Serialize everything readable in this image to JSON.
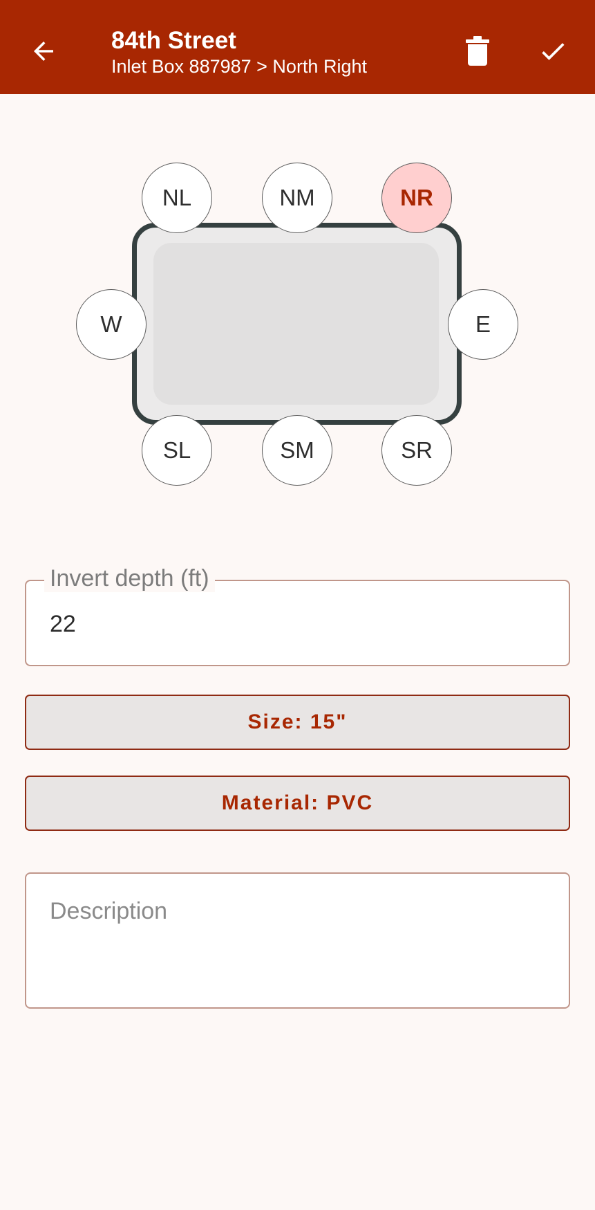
{
  "app_bar": {
    "title": "84th Street",
    "subtitle": "Inlet Box 887987 > North Right",
    "background_color": "#a82702",
    "icons": {
      "back": "arrow-left-icon",
      "delete": "trash-icon",
      "confirm": "check-icon"
    }
  },
  "diagram": {
    "ports": {
      "nl": "NL",
      "nm": "NM",
      "nr": "NR",
      "w": "W",
      "e": "E",
      "sl": "SL",
      "sm": "SM",
      "sr": "SR"
    },
    "selected_port": "NR",
    "selected_color": "#ffcfcf"
  },
  "form": {
    "invert_depth": {
      "label": "Invert depth (ft)",
      "value": "22"
    },
    "size_button": "Size: 15\"",
    "material_button": "Material: PVC",
    "description": {
      "placeholder": "Description",
      "value": ""
    }
  }
}
